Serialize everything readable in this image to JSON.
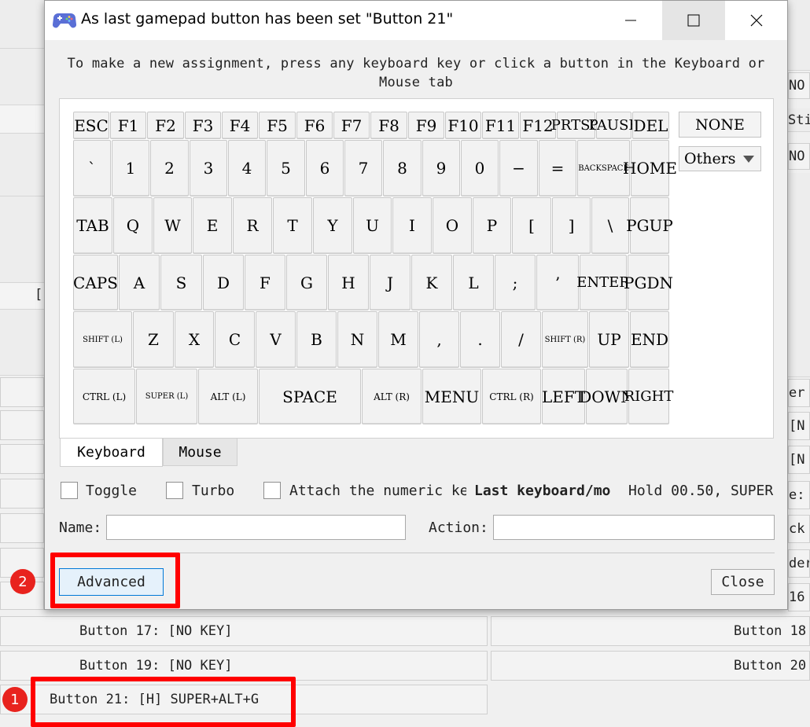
{
  "background": {
    "right_fragments": [
      "NO",
      "Sti",
      "NO",
      "er",
      "[N",
      "[N",
      "e:",
      "ck",
      "der",
      "16"
    ],
    "left_fragment": "[",
    "bottom_rows": [
      {
        "left": "Button 17: [NO KEY]",
        "right": "Button 18"
      },
      {
        "left": "Button 19: [NO KEY]",
        "right": "Button 20"
      },
      {
        "left": "Button 21: [H] SUPER+ALT+G",
        "right": ""
      }
    ]
  },
  "dialog": {
    "title": "As last gamepad button has been set \"Button 21\"",
    "instruction": "To make a new assignment, press any keyboard key or click a button in the Keyboard or Mouse tab",
    "keyboard_rows": [
      [
        "ESC",
        "F1",
        "F2",
        "F3",
        "F4",
        "F5",
        "F6",
        "F7",
        "F8",
        "F9",
        "F10",
        "F11",
        "F12",
        "PRTSC",
        "PAUSE",
        "DEL"
      ],
      [
        "`",
        "1",
        "2",
        "3",
        "4",
        "5",
        "6",
        "7",
        "8",
        "9",
        "0",
        "−",
        "=",
        "BACKSPACE",
        "HOME"
      ],
      [
        "TAB",
        "Q",
        "W",
        "E",
        "R",
        "T",
        "Y",
        "U",
        "I",
        "O",
        "P",
        "[",
        "]",
        "\\",
        "PGUP"
      ],
      [
        "CAPS",
        "A",
        "S",
        "D",
        "F",
        "G",
        "H",
        "J",
        "K",
        "L",
        ";",
        "’",
        "ENTER",
        "PGDN"
      ],
      [
        "SHIFT (L)",
        "Z",
        "X",
        "C",
        "V",
        "B",
        "N",
        "M",
        ",",
        ".",
        "/",
        "SHIFT (R)",
        "UP",
        "END"
      ],
      [
        "CTRL (L)",
        "SUPER (L)",
        "ALT (L)",
        "SPACE",
        "ALT (R)",
        "MENU",
        "CTRL (R)",
        "LEFT",
        "DOWN",
        "RIGHT"
      ]
    ],
    "none_button": "NONE",
    "others_select": "Others",
    "tabs": [
      "Keyboard",
      "Mouse"
    ],
    "checkboxes": [
      "Toggle",
      "Turbo",
      "Attach the numeric ke"
    ],
    "last_keyboard_label": "Last keyboard/mo",
    "hold_text": "Hold 00.50, SUPER",
    "name_label": "Name:",
    "action_label": "Action:",
    "advanced_button": "Advanced",
    "close_button": "Close"
  },
  "badges": [
    "1",
    "2"
  ],
  "colors": {
    "highlight": "#ff0000",
    "badge": "#e8231e"
  }
}
